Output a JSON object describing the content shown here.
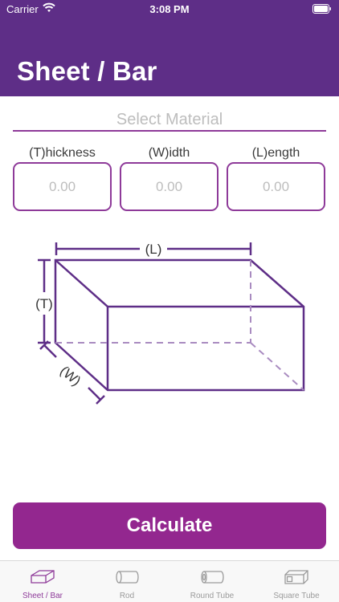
{
  "status": {
    "carrier": "Carrier",
    "time": "3:08 PM"
  },
  "header": {
    "title": "Sheet / Bar"
  },
  "material": {
    "placeholder": "Select Material"
  },
  "dimensions": [
    {
      "label": "(T)hickness",
      "value": "0.00"
    },
    {
      "label": "(W)idth",
      "value": "0.00"
    },
    {
      "label": "(L)ength",
      "value": "0.00"
    }
  ],
  "diagram": {
    "length_label": "(L)",
    "thickness_label": "(T)",
    "width_label": "(W)"
  },
  "actions": {
    "calculate": "Calculate"
  },
  "tabs": [
    {
      "label": "Sheet / Bar",
      "icon": "sheet-bar-icon",
      "active": true
    },
    {
      "label": "Rod",
      "icon": "rod-icon"
    },
    {
      "label": "Round Tube",
      "icon": "round-tube-icon"
    },
    {
      "label": "Square Tube",
      "icon": "square-tube-icon"
    }
  ],
  "colors": {
    "header": "#5e2e87",
    "accent": "#8e3a99",
    "button": "#93278f",
    "tab_inactive": "#9a9a9a"
  }
}
